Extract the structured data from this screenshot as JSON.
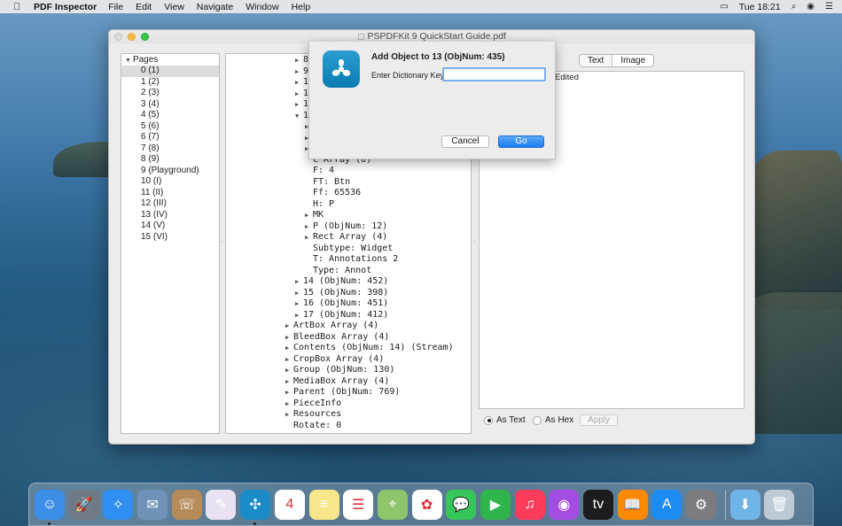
{
  "menubar": {
    "apple_icon": "apple-icon",
    "app_name": "PDF Inspector",
    "items": [
      "File",
      "Edit",
      "View",
      "Navigate",
      "Window",
      "Help"
    ],
    "clock": "Tue 18:21",
    "status_icons": [
      "display-icon",
      "search-icon",
      "siri-icon",
      "control-center-icon"
    ]
  },
  "window": {
    "title": "PSPDFKit 9 QuickStart Guide.pdf",
    "pages_header": "Pages",
    "pages": [
      "0 (1)",
      "1 (2)",
      "2 (3)",
      "3 (4)",
      "4 (5)",
      "5 (6)",
      "6 (7)",
      "7 (8)",
      "8 (9)",
      "9 (Playground)",
      "10 (I)",
      "11 (II)",
      "12 (III)",
      "13 (IV)",
      "14 (V)",
      "15 (VI)"
    ],
    "selected_page": "0 (1)",
    "tree_rows": [
      {
        "label": "8",
        "indent": 3,
        "toggle": "collapsed"
      },
      {
        "label": "9",
        "indent": 3,
        "toggle": "collapsed"
      },
      {
        "label": "10",
        "indent": 3,
        "toggle": "collapsed"
      },
      {
        "label": "11",
        "indent": 3,
        "toggle": "collapsed"
      },
      {
        "label": "12",
        "indent": 3,
        "toggle": "collapsed"
      },
      {
        "label": "13",
        "indent": 3,
        "toggle": "expanded"
      },
      {
        "label": "",
        "indent": 4,
        "toggle": "collapsed"
      },
      {
        "label": "",
        "indent": 4,
        "toggle": "collapsed"
      },
      {
        "label": "",
        "indent": 4,
        "toggle": "collapsed"
      },
      {
        "label": "C Array (0)",
        "indent": 4,
        "toggle": "none"
      },
      {
        "label": "F: 4",
        "indent": 4,
        "toggle": "none"
      },
      {
        "label": "FT: Btn",
        "indent": 4,
        "toggle": "none"
      },
      {
        "label": "Ff: 65536",
        "indent": 4,
        "toggle": "none"
      },
      {
        "label": "H: P",
        "indent": 4,
        "toggle": "none"
      },
      {
        "label": "MK",
        "indent": 4,
        "toggle": "collapsed"
      },
      {
        "label": "P (ObjNum: 12)",
        "indent": 4,
        "toggle": "collapsed"
      },
      {
        "label": "Rect Array (4)",
        "indent": 4,
        "toggle": "collapsed"
      },
      {
        "label": "Subtype: Widget",
        "indent": 4,
        "toggle": "none"
      },
      {
        "label": "T: Annotations 2",
        "indent": 4,
        "toggle": "none"
      },
      {
        "label": "Type: Annot",
        "indent": 4,
        "toggle": "none"
      },
      {
        "label": "14 (ObjNum: 452)",
        "indent": 3,
        "toggle": "collapsed"
      },
      {
        "label": "15 (ObjNum: 398)",
        "indent": 3,
        "toggle": "collapsed"
      },
      {
        "label": "16 (ObjNum: 451)",
        "indent": 3,
        "toggle": "collapsed"
      },
      {
        "label": "17 (ObjNum: 412)",
        "indent": 3,
        "toggle": "collapsed"
      },
      {
        "label": "ArtBox Array (4)",
        "indent": 2,
        "toggle": "collapsed"
      },
      {
        "label": "BleedBox Array (4)",
        "indent": 2,
        "toggle": "collapsed"
      },
      {
        "label": "Contents (ObjNum: 14) (Stream)",
        "indent": 2,
        "toggle": "collapsed"
      },
      {
        "label": "CropBox Array (4)",
        "indent": 2,
        "toggle": "collapsed"
      },
      {
        "label": "Group (ObjNum: 130)",
        "indent": 2,
        "toggle": "collapsed"
      },
      {
        "label": "MediaBox Array (4)",
        "indent": 2,
        "toggle": "collapsed"
      },
      {
        "label": "Parent (ObjNum: 769)",
        "indent": 2,
        "toggle": "collapsed"
      },
      {
        "label": "PieceInfo",
        "indent": 2,
        "toggle": "collapsed"
      },
      {
        "label": "Resources",
        "indent": 2,
        "toggle": "collapsed"
      },
      {
        "label": "Rotate: 0",
        "indent": 2,
        "toggle": "none"
      }
    ],
    "tabs": [
      "Text",
      "Image"
    ],
    "detail_text": "Edited",
    "radio_as_text": "As Text",
    "radio_as_hex": "As Hex",
    "apply_label": "Apply"
  },
  "sheet": {
    "title": "Add Object to 13 (ObjNum: 435)",
    "field_label": "Enter Dictionary Key:",
    "field_value": "",
    "cancel_label": "Cancel",
    "go_label": "Go"
  },
  "dock": {
    "apps": [
      {
        "name": "finder-icon",
        "bg": "#3d8ee6",
        "glyph": "☺",
        "running": true
      },
      {
        "name": "launchpad-icon",
        "bg": "#6f7a86",
        "glyph": "🚀",
        "running": false
      },
      {
        "name": "safari-icon",
        "bg": "#2f8ff2",
        "glyph": "✧",
        "running": false
      },
      {
        "name": "mail-bird-icon",
        "bg": "#6f93b8",
        "glyph": "✉",
        "running": false
      },
      {
        "name": "contacts-icon",
        "bg": "#b58b5a",
        "glyph": "☏",
        "running": false
      },
      {
        "name": "script-editor-icon",
        "bg": "#e9e2f2",
        "glyph": "✎",
        "running": false
      },
      {
        "name": "pdf-inspector-icon",
        "bg": "#1a8bc6",
        "glyph": "✣",
        "running": true
      },
      {
        "name": "calendar-icon",
        "bg": "#ffffff",
        "glyph": "4",
        "running": false
      },
      {
        "name": "notes-icon",
        "bg": "#f7e78a",
        "glyph": "≡",
        "running": false
      },
      {
        "name": "reminders-icon",
        "bg": "#ffffff",
        "glyph": "☰",
        "running": false
      },
      {
        "name": "maps-icon",
        "bg": "#8ec56a",
        "glyph": "⌖",
        "running": false
      },
      {
        "name": "photos-icon",
        "bg": "#ffffff",
        "glyph": "✿",
        "running": false
      },
      {
        "name": "messages-icon",
        "bg": "#35c759",
        "glyph": "💬",
        "running": false
      },
      {
        "name": "facetime-icon",
        "bg": "#2fb54b",
        "glyph": "▶",
        "running": false
      },
      {
        "name": "music-icon",
        "bg": "#ff3b5b",
        "glyph": "♫",
        "running": false
      },
      {
        "name": "podcasts-icon",
        "bg": "#a44de3",
        "glyph": "◉",
        "running": false
      },
      {
        "name": "apple-tv-icon",
        "bg": "#1c1c1e",
        "glyph": "tv",
        "running": false
      },
      {
        "name": "books-icon",
        "bg": "#ff8a00",
        "glyph": "📖",
        "running": false
      },
      {
        "name": "app-store-icon",
        "bg": "#1d8cf2",
        "glyph": "A",
        "running": false
      },
      {
        "name": "system-preferences-icon",
        "bg": "#7b7b80",
        "glyph": "⚙",
        "running": false
      }
    ],
    "trailing": [
      {
        "name": "downloads-folder-icon",
        "bg": "#6fb4e6",
        "glyph": "⬇"
      },
      {
        "name": "trash-icon",
        "bg": "rgba(230,235,240,0.7)",
        "glyph": "🗑"
      }
    ]
  }
}
